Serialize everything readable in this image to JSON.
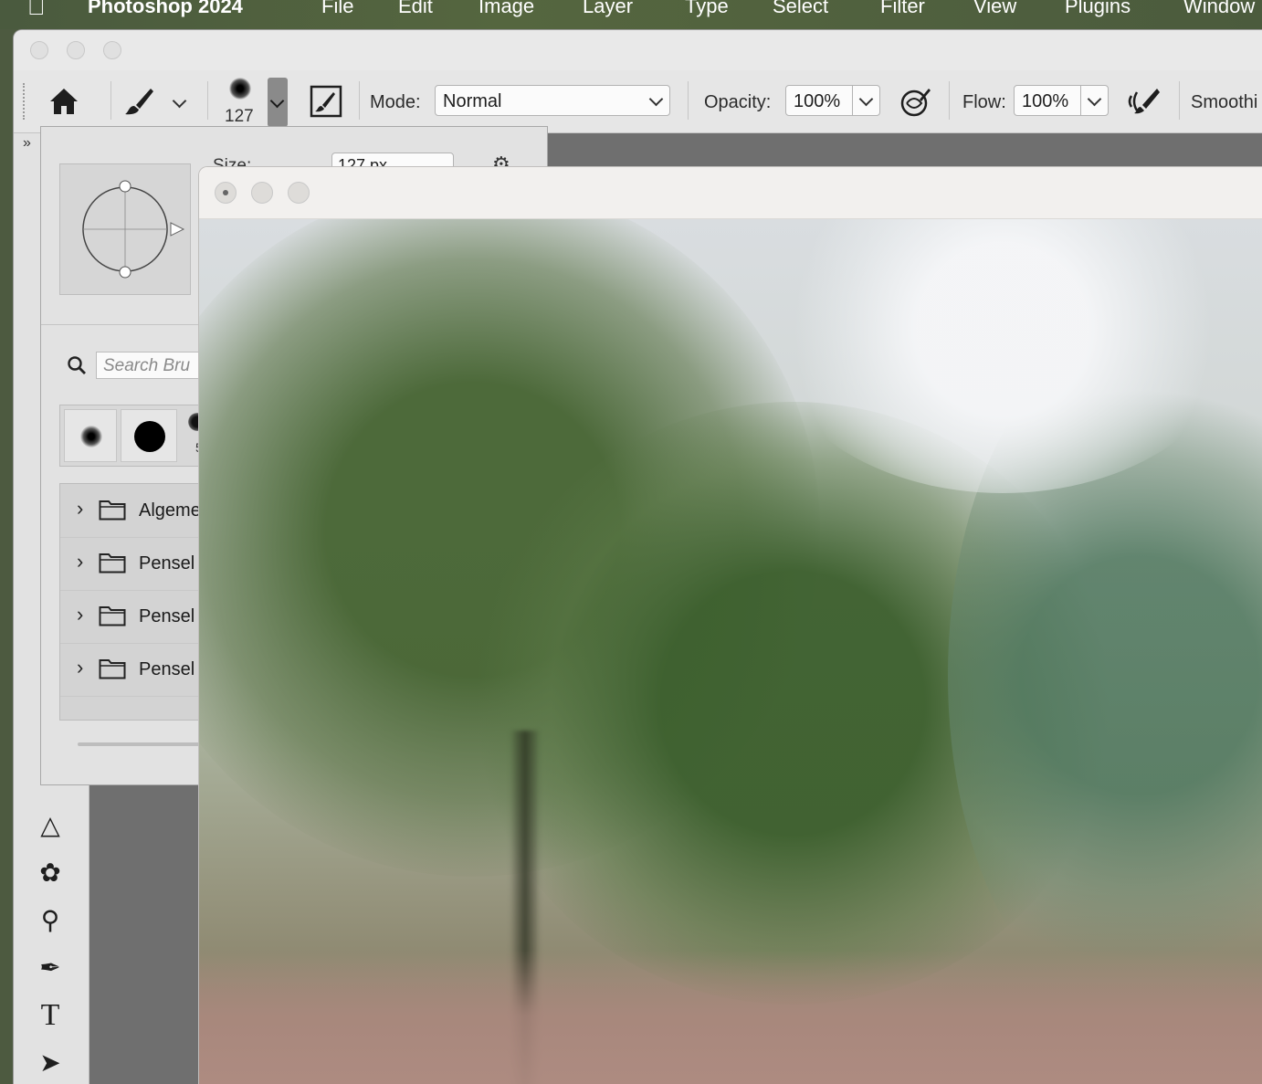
{
  "menubar": {
    "app_name": "Photoshop 2024",
    "items": [
      "File",
      "Edit",
      "Image",
      "Layer",
      "Type",
      "Select",
      "Filter",
      "View",
      "Plugins",
      "Window"
    ]
  },
  "options_bar": {
    "brush_size": "127",
    "mode_label": "Mode:",
    "mode_value": "Normal",
    "opacity_label": "Opacity:",
    "opacity_value": "100%",
    "flow_label": "Flow:",
    "flow_value": "100%",
    "smoothing_label": "Smoothi"
  },
  "brush_panel": {
    "size_label": "Size:",
    "size_value": "127 px",
    "search_placeholder": "Search Bru",
    "preset_partial_label": "5",
    "folders": [
      "Algeme",
      "Pensel",
      "Pensel",
      "Pensel"
    ]
  },
  "colors": {
    "menubar_bg": "#4f603f",
    "panel_bg": "#e2e2e2",
    "workarea_bg": "#6f6f6f"
  }
}
